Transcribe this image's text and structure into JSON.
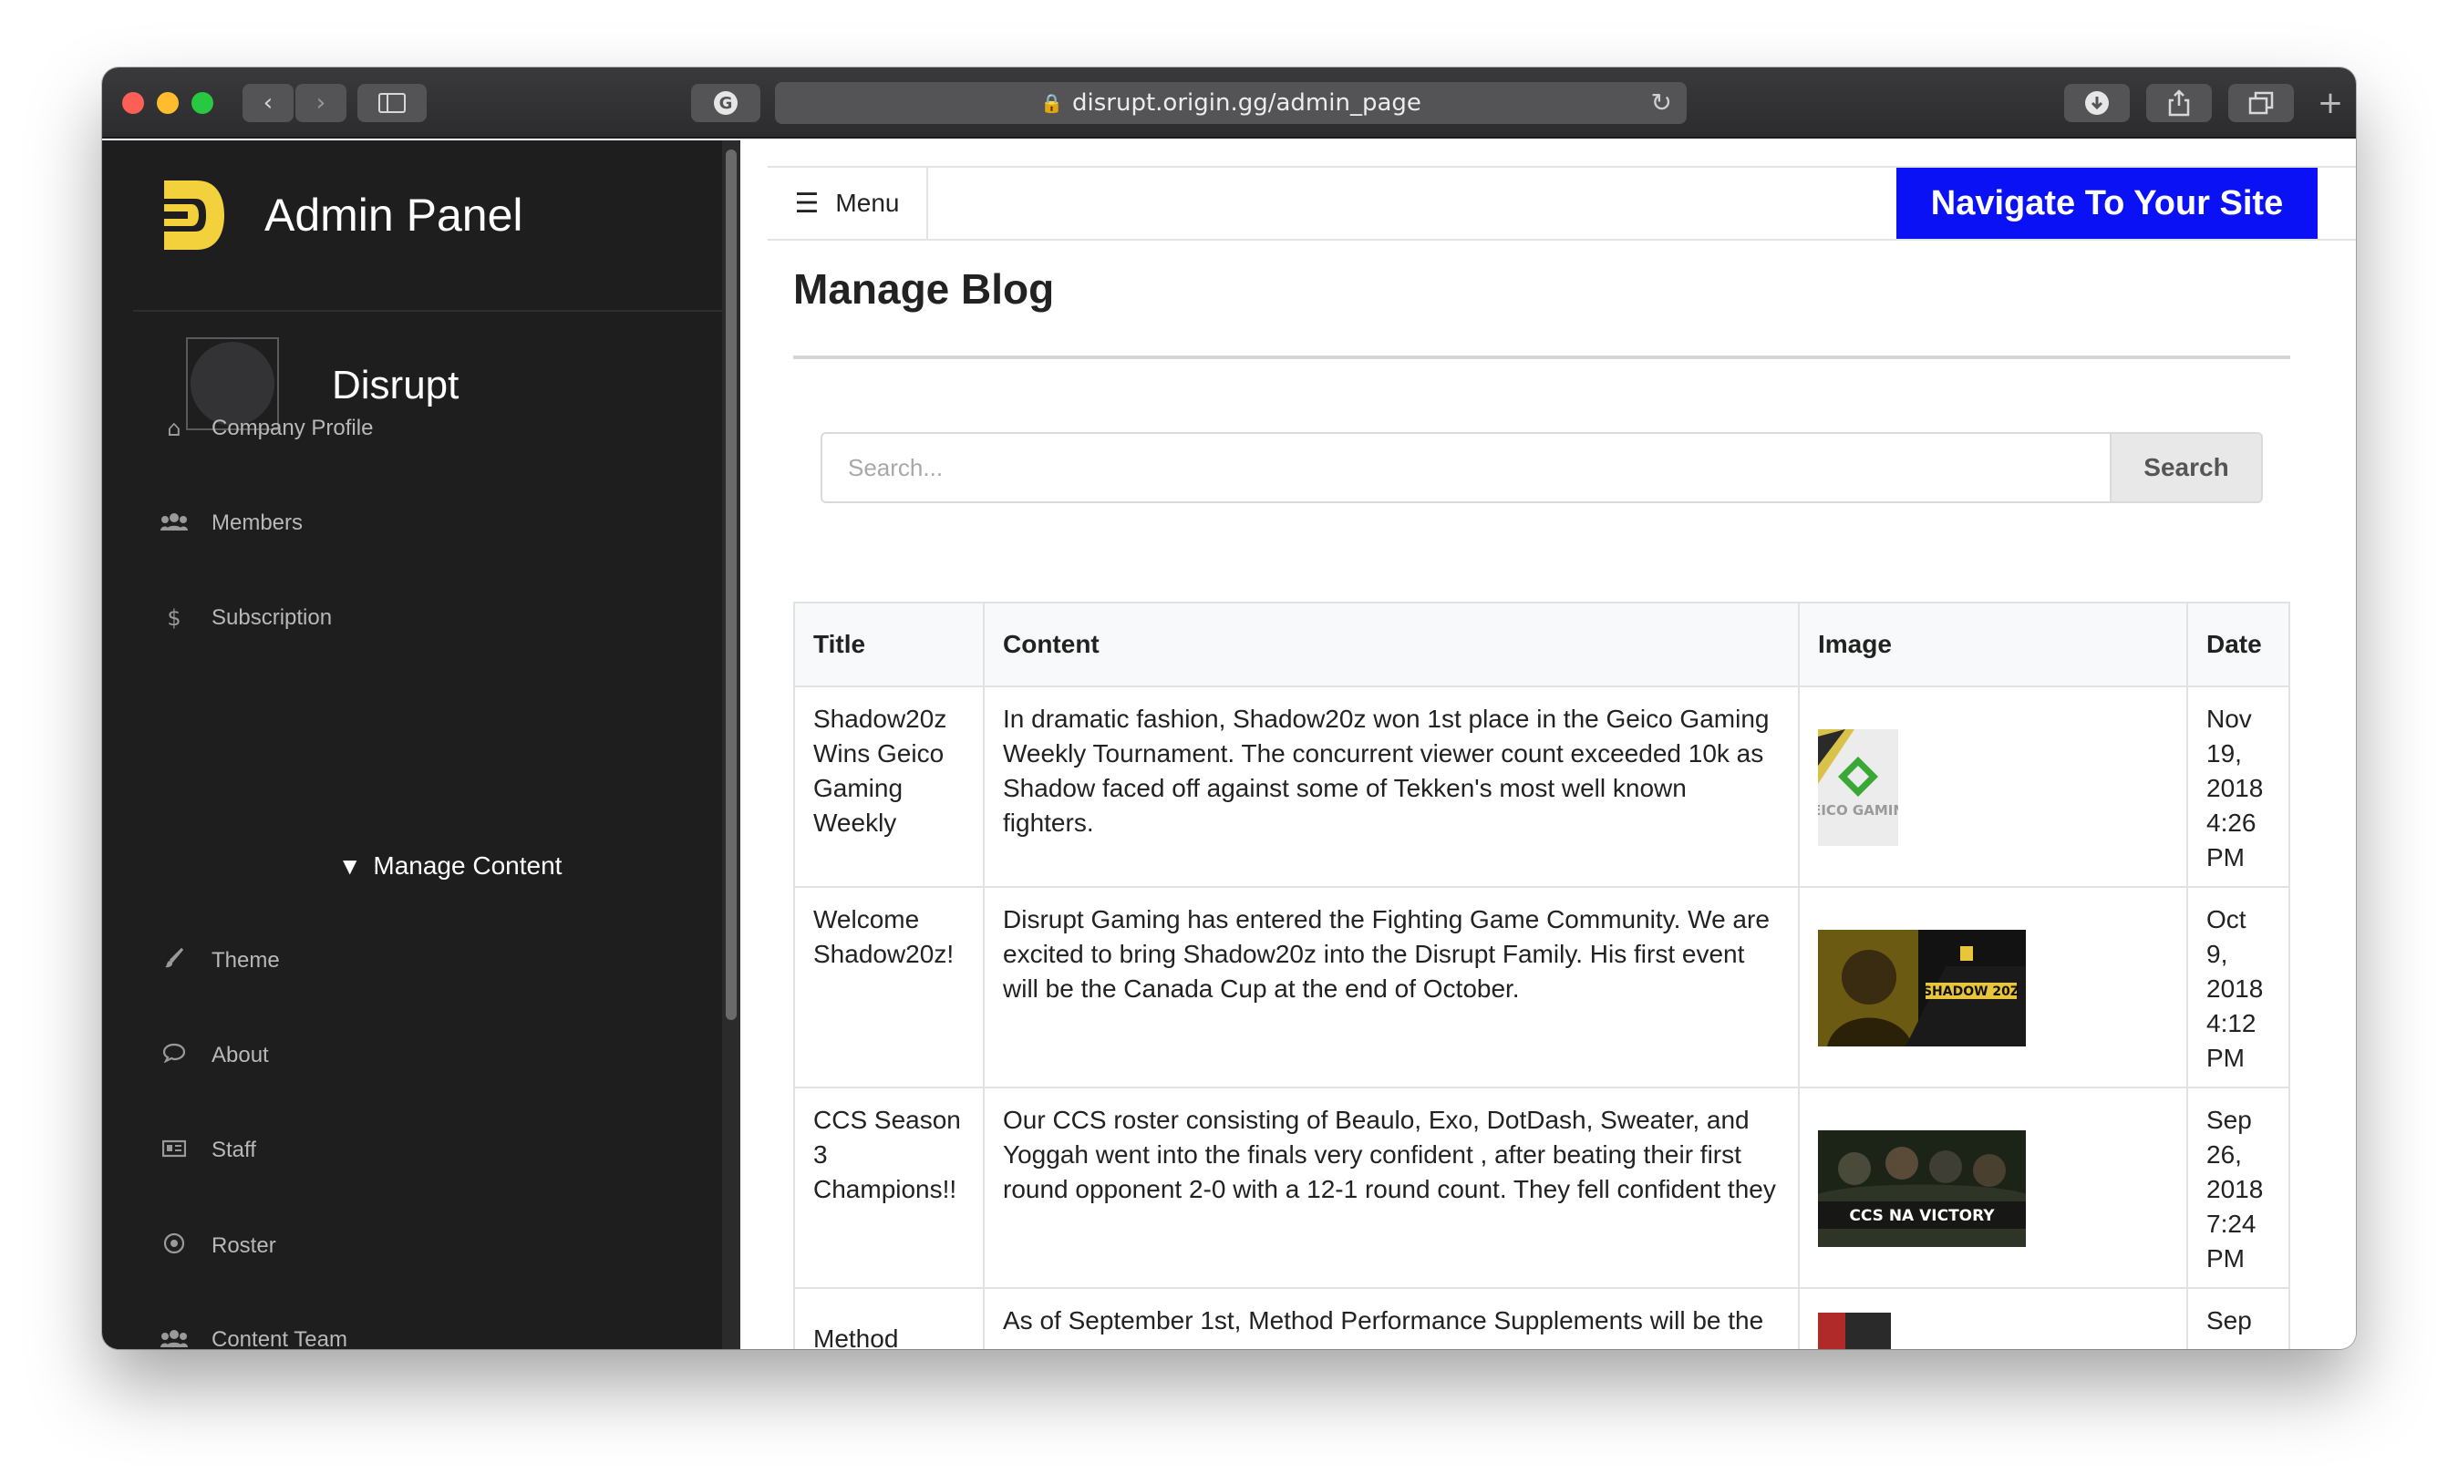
{
  "browser": {
    "url": "disrupt.origin.gg/admin_page"
  },
  "sidebar": {
    "brand": "Admin Panel",
    "org_name": "Disrupt",
    "items": [
      {
        "label": "Company Profile",
        "icon": "home-icon"
      },
      {
        "label": "Members",
        "icon": "users-icon"
      },
      {
        "label": "Subscription",
        "icon": "dollar-icon"
      }
    ],
    "section": {
      "label": "Manage Content",
      "icon": "caret-down-icon"
    },
    "content_items": [
      {
        "label": "Theme",
        "icon": "brush-icon"
      },
      {
        "label": "About",
        "icon": "comment-icon"
      },
      {
        "label": "Staff",
        "icon": "id-card-icon"
      },
      {
        "label": "Roster",
        "icon": "dot-circle-icon"
      },
      {
        "label": "Content Team",
        "icon": "users-icon"
      }
    ]
  },
  "topnav": {
    "menu_label": "Menu",
    "navigate_label": "Navigate To Your Site"
  },
  "main": {
    "title": "Manage Blog",
    "search": {
      "placeholder": "Search...",
      "button": "Search"
    },
    "table": {
      "headers": [
        "Title",
        "Content",
        "Image",
        "Date"
      ],
      "rows": [
        {
          "title": "Shadow20z Wins Geico Gaming Weekly",
          "content": "In dramatic fashion, Shadow20z won 1st place in the Geico Gaming Weekly Tournament. The concurrent viewer count exceeded 10k as Shadow faced off against some of Tekken's most well known fighters.",
          "image_text": "GEICO GAMING",
          "date": "Nov 19, 2018 4:26 PM"
        },
        {
          "title": "Welcome Shadow20z!",
          "content": "Disrupt Gaming has entered the Fighting Game Community. We are excited to bring Shadow20z into the Disrupt Family. His first event will be the Canada Cup at the end of October.",
          "image_text": "SHADOW 20Z",
          "date": "Oct 9, 2018 4:12 PM"
        },
        {
          "title": "CCS Season 3 Champions!!",
          "content": "Our CCS roster consisting of Beaulo, Exo, DotDash, Sweater, and Yoggah went into the finals very confident , after beating their first round opponent 2-0 with a 12-1 round count. They fell confident they",
          "image_text": "CCS NA VICTORY",
          "date": "Sep 26, 2018 7:24 PM"
        },
        {
          "title": "Method",
          "content": "As of September 1st, Method Performance Supplements will be the",
          "image_text": "",
          "date": "Sep"
        }
      ]
    }
  },
  "colors": {
    "sidebar_bg": "#1e1e1f",
    "accent_button": "#0a12f5",
    "brand_logo": "#f2d13c"
  }
}
